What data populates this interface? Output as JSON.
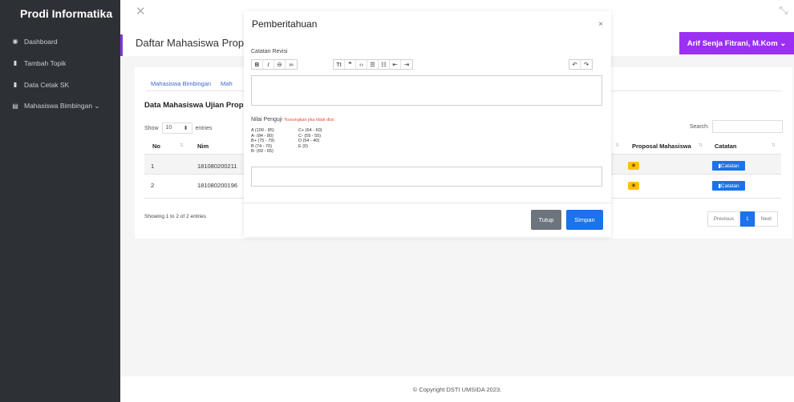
{
  "sidebar": {
    "brand": "Prodi Informatika",
    "items": [
      {
        "icon": "dashboard-icon",
        "glyph": "◉",
        "label": "Dashboard"
      },
      {
        "icon": "file-icon",
        "glyph": "▮",
        "label": "Tambah Topik"
      },
      {
        "icon": "file-icon",
        "glyph": "▮",
        "label": "Data Cetak SK"
      },
      {
        "icon": "table-icon",
        "glyph": "▤",
        "label": "Mahasiswa Bimbingan ⌄"
      }
    ]
  },
  "topbar": {
    "close_glyph": "✕",
    "collapse_glyph": "⤡",
    "page_title": "Daftar Mahasiswa Prop",
    "user_label": "Arif Senja Fitrani, M.Kom ⌄"
  },
  "card": {
    "tabs": [
      "Mahasiswa Bimbingan",
      "Mah"
    ],
    "heading": "Data Mahasiswa Ujian Propos",
    "show_label": "Show",
    "entries_value": "10",
    "entries_label": "entries",
    "search_label": "Search:",
    "columns": {
      "no": "No",
      "nim": "Nim",
      "proposal": "Proposal Mahasiswa",
      "catatan": "Catatan"
    },
    "rows": [
      {
        "no": "1",
        "nim": "181080200211",
        "note_label": "Catatan"
      },
      {
        "no": "2",
        "nim": "181080200196",
        "note_label": "Catatan"
      }
    ],
    "info": "Showing 1 to 2 of 2 entries",
    "pager": {
      "prev": "Previous",
      "current": "1",
      "next": "Next"
    }
  },
  "footer": "© Copyright DSTI UMSIDA 2023.",
  "modal": {
    "title": "Pemberitahuan",
    "close_glyph": "×",
    "catatan_label": "Catatan Revisi",
    "nilai_label": "Nilai Penguji",
    "nilai_hint": "*kosongkan jika tidak diisi",
    "grades_left": [
      "A (100 - 85)",
      "A- (84 - 80)",
      "B+ (75 - 79)",
      "B (74 - 70)",
      "B- (69 - 65)"
    ],
    "grades_right": [
      "C+ (64 - 60)",
      "C- (59 - 55)",
      "D (54 - 40)",
      "E (0)"
    ],
    "btn_tutup": "Tutup",
    "btn_simpan": "Simpan"
  }
}
